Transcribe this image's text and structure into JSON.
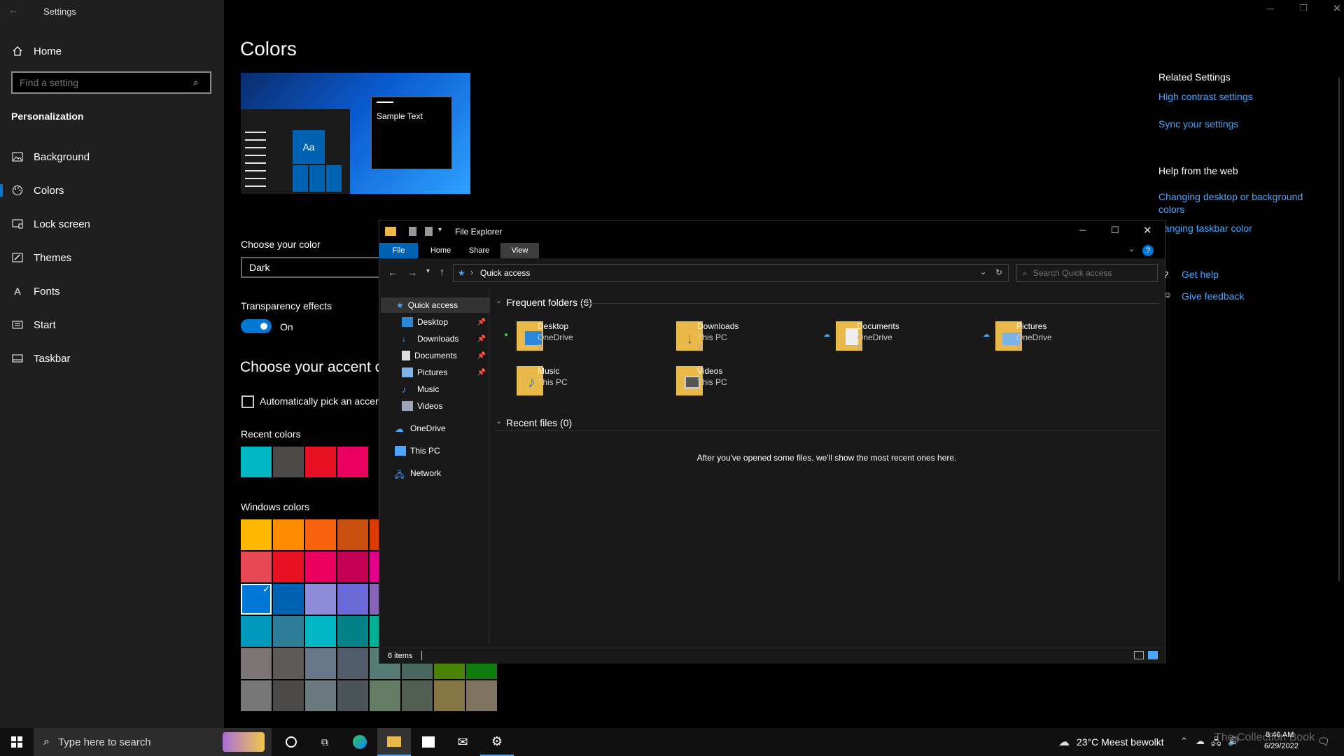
{
  "settings": {
    "title": "Settings",
    "search_placeholder": "Find a setting",
    "home_label": "Home",
    "section": "Personalization",
    "nav": [
      {
        "label": "Background",
        "icon": "picture-icon"
      },
      {
        "label": "Colors",
        "icon": "palette-icon"
      },
      {
        "label": "Lock screen",
        "icon": "lock-screen-icon"
      },
      {
        "label": "Themes",
        "icon": "brush-icon"
      },
      {
        "label": "Fonts",
        "icon": "font-icon"
      },
      {
        "label": "Start",
        "icon": "start-icon"
      },
      {
        "label": "Taskbar",
        "icon": "taskbar-icon"
      }
    ],
    "page_title": "Colors",
    "preview_sample": "Sample Text",
    "preview_tile": "Aa",
    "choose_color_label": "Choose your color",
    "choose_color_value": "Dark",
    "transparency_label": "Transparency effects",
    "transparency_value": "On",
    "accent_heading": "Choose your accent co",
    "auto_pick_label": "Automatically pick an accen",
    "recent_colors_label": "Recent colors",
    "recent_colors": [
      "#00b7c3",
      "#4c4a48",
      "#e81123",
      "#ea005e"
    ],
    "windows_colors_label": "Windows colors",
    "windows_colors_rows": [
      [
        "#ffb900",
        "#ff8c00",
        "#f7630c",
        "#ca5010",
        "#da3b01"
      ],
      [
        "#e74856",
        "#e81123",
        "#ea005e",
        "#c30052",
        "#e3008c"
      ],
      [
        "#0078d7",
        "#0063b1",
        "#8e8cd8",
        "#6b69d6",
        "#8764b8"
      ],
      [
        "#0099bc",
        "#2d7d9a",
        "#00b7c3",
        "#038387",
        "#00b294"
      ],
      [
        "#7a7574",
        "#5d5a58",
        "#68768a",
        "#515c6b",
        "#567c73",
        "#486860",
        "#498205",
        "#107c10"
      ],
      [
        "#767676",
        "#4c4a48",
        "#69797e",
        "#4a5459",
        "#647c64",
        "#525e54",
        "#847545",
        "#7e735f"
      ]
    ],
    "related_heading": "Related Settings",
    "related_links": [
      "High contrast settings",
      "Sync your settings"
    ],
    "help_heading": "Help from the web",
    "help_links": [
      "Changing desktop or background colors",
      "hanging taskbar color"
    ],
    "get_help": "Get help",
    "give_feedback": "Give feedback"
  },
  "explorer": {
    "title": "File Explorer",
    "tabs": [
      "File",
      "Home",
      "Share",
      "View"
    ],
    "address": "Quick access",
    "search_placeholder": "Search Quick access",
    "nav_quick": "Quick access",
    "nav_pinned": [
      "Desktop",
      "Downloads",
      "Documents",
      "Pictures"
    ],
    "nav_unpinned": [
      "Music",
      "Videos"
    ],
    "nav_onedrive": "OneDrive",
    "nav_thispc": "This PC",
    "nav_network": "Network",
    "frequent_heading": "Frequent folders (6)",
    "folders": [
      {
        "name": "Desktop",
        "location": "OneDrive"
      },
      {
        "name": "Downloads",
        "location": "This PC"
      },
      {
        "name": "Documents",
        "location": "OneDrive"
      },
      {
        "name": "Pictures",
        "location": "OneDrive"
      },
      {
        "name": "Music",
        "location": "This PC"
      },
      {
        "name": "Videos",
        "location": "This PC"
      }
    ],
    "recent_heading": "Recent files (0)",
    "recent_empty": "After you've opened some files, we'll show the most recent ones here.",
    "status_items": "6 items"
  },
  "taskbar": {
    "search_placeholder": "Type here to search",
    "weather": "23°C  Meest bewolkt",
    "time": "8:46 AM",
    "date": "6/29/2022",
    "watermark": "The Collection Book"
  },
  "colors": {
    "accent": "#0078d4",
    "link": "#4aa6ff"
  }
}
